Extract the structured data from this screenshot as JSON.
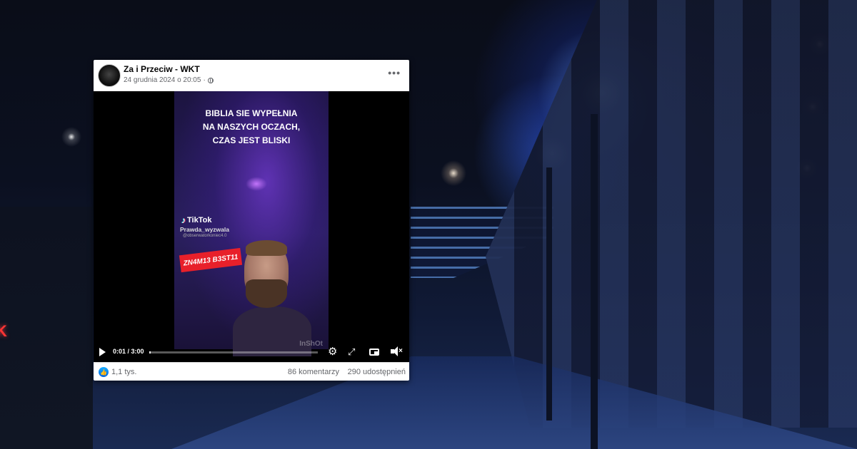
{
  "post": {
    "page_name": "Za i Przeciw - WKT",
    "timestamp": "24 grudnia 2024 o 20:05",
    "timestamp_separator": "·",
    "more_label": "•••"
  },
  "video": {
    "caption_line1": "BIBLIA SIE WYPEŁNIA",
    "caption_line2": "NA NASZYCH OCZACH,",
    "caption_line3": "CZAS JEST BLISKI",
    "tiktok_label": "TikTok",
    "tiktok_handle": "Prawda_wyzwala",
    "tiktok_sub": "@obserwatorkoniec4.0",
    "sticker_text": "ZN4M13 B3ST11",
    "watermark": "InShOt",
    "current_time": "0:01",
    "duration": "3:00",
    "time_separator": " / ",
    "progress_fraction": 0.0056
  },
  "footer": {
    "reactions": "1,1 tys.",
    "comments": "86 komentarzy",
    "shares": "290 udostępnień"
  },
  "icons": {
    "like": "thumbs-up-icon",
    "settings": "gear-icon",
    "fullscreen": "expand-icon",
    "pip": "picture-in-picture-icon",
    "volume": "volume-muted-icon",
    "play": "play-icon",
    "privacy": "globe-icon"
  },
  "colors": {
    "like_blue": "#0866ff",
    "sticker_red": "#e8202a",
    "text_secondary": "#65676b"
  }
}
